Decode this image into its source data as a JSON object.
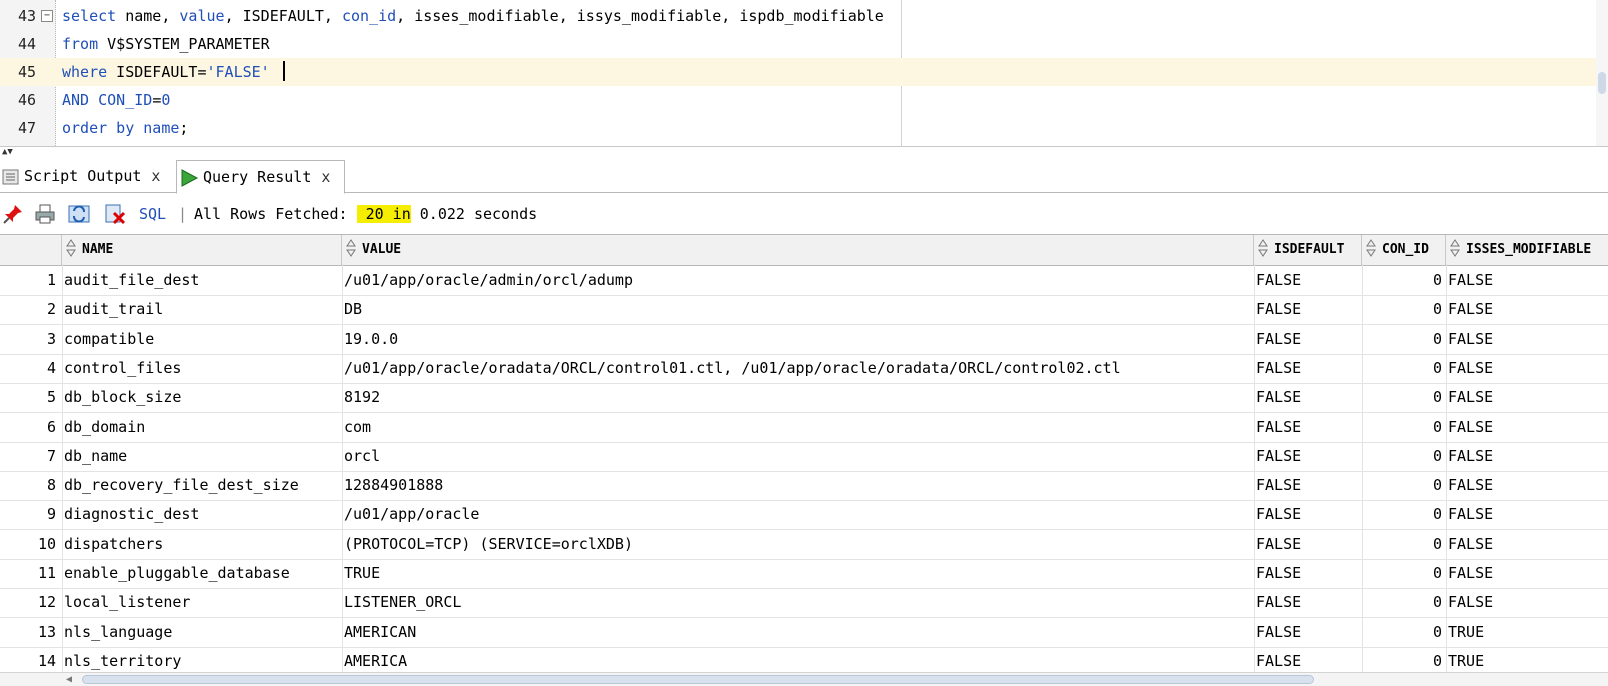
{
  "editor": {
    "lines": [
      {
        "num": "43",
        "tokens": [
          [
            "kw",
            "select"
          ],
          [
            "t",
            " name, "
          ],
          [
            "kw",
            "value"
          ],
          [
            "t",
            ", ISDEFAULT, "
          ],
          [
            "kw",
            "con_id"
          ],
          [
            "t",
            ", isses_modifiable, issys_modifiable, ispdb_modifiable"
          ]
        ]
      },
      {
        "num": "44",
        "tokens": [
          [
            "kw",
            "from"
          ],
          [
            "t",
            " V$SYSTEM_PARAMETER"
          ]
        ]
      },
      {
        "num": "45",
        "tokens": [
          [
            "kw",
            "where"
          ],
          [
            "t",
            " ISDEFAULT="
          ],
          [
            "str",
            "'FALSE'"
          ],
          [
            "t",
            " "
          ]
        ]
      },
      {
        "num": "46",
        "tokens": [
          [
            "kw",
            "AND"
          ],
          [
            "t",
            " "
          ],
          [
            "kw",
            "CON_ID"
          ],
          [
            "t",
            "="
          ],
          [
            "num",
            "0"
          ]
        ]
      },
      {
        "num": "47",
        "tokens": [
          [
            "kw",
            "order by"
          ],
          [
            "t",
            " "
          ],
          [
            "kw",
            "name"
          ],
          [
            "t",
            ";"
          ]
        ]
      }
    ],
    "fold_symbol": "−"
  },
  "tabs": [
    {
      "label": "Script Output",
      "close": "x",
      "icon": "script-output-icon"
    },
    {
      "label": "Query Result",
      "close": "x",
      "icon": "run-query-icon"
    }
  ],
  "toolbar": {
    "icons": [
      "pin-icon",
      "print-icon",
      "refresh-icon",
      "clear-icon"
    ],
    "sql_label": "SQL",
    "separator": "|",
    "status_prefix": "All Rows Fetched: ",
    "status_count": "20",
    "status_in": " in",
    "status_suffix": " 0.022 seconds"
  },
  "grid": {
    "columns": [
      "NAME",
      "VALUE",
      "ISDEFAULT",
      "CON_ID",
      "ISSES_MODIFIABLE"
    ],
    "rows": [
      [
        "1",
        "audit_file_dest",
        "/u01/app/oracle/admin/orcl/adump",
        "FALSE",
        "0",
        "FALSE"
      ],
      [
        "2",
        "audit_trail",
        "DB",
        "FALSE",
        "0",
        "FALSE"
      ],
      [
        "3",
        "compatible",
        "19.0.0",
        "FALSE",
        "0",
        "FALSE"
      ],
      [
        "4",
        "control_files",
        "/u01/app/oracle/oradata/ORCL/control01.ctl, /u01/app/oracle/oradata/ORCL/control02.ctl",
        "FALSE",
        "0",
        "FALSE"
      ],
      [
        "5",
        "db_block_size",
        "8192",
        "FALSE",
        "0",
        "FALSE"
      ],
      [
        "6",
        "db_domain",
        "com",
        "FALSE",
        "0",
        "FALSE"
      ],
      [
        "7",
        "db_name",
        "orcl",
        "FALSE",
        "0",
        "FALSE"
      ],
      [
        "8",
        "db_recovery_file_dest_size",
        "12884901888",
        "FALSE",
        "0",
        "FALSE"
      ],
      [
        "9",
        "diagnostic_dest",
        "/u01/app/oracle",
        "FALSE",
        "0",
        "FALSE"
      ],
      [
        "10",
        "dispatchers",
        "(PROTOCOL=TCP) (SERVICE=orclXDB)",
        "FALSE",
        "0",
        "FALSE"
      ],
      [
        "11",
        "enable_pluggable_database",
        "TRUE",
        "FALSE",
        "0",
        "FALSE"
      ],
      [
        "12",
        "local_listener",
        "LISTENER_ORCL",
        "FALSE",
        "0",
        "FALSE"
      ],
      [
        "13",
        "nls_language",
        "AMERICAN",
        "FALSE",
        "0",
        "TRUE"
      ],
      [
        "14",
        "nls_territory",
        "AMERICA",
        "FALSE",
        "0",
        "TRUE"
      ]
    ]
  },
  "colors": {
    "keyword": "#1f4fb8",
    "highlight": "#f5ee00",
    "current_line": "#fdf6e0"
  }
}
